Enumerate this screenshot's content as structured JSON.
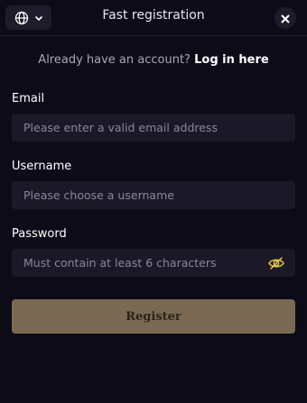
{
  "header": {
    "title": "Fast registration",
    "language_icon": "globe-icon",
    "dropdown_icon": "chevron-down-icon",
    "close_icon": "close-icon"
  },
  "login_prompt": {
    "text": "Already have an account?",
    "link": "Log in here"
  },
  "form": {
    "email": {
      "label": "Email",
      "placeholder": "Please enter a valid email address",
      "value": ""
    },
    "username": {
      "label": "Username",
      "placeholder": "Please choose a username",
      "value": ""
    },
    "password": {
      "label": "Password",
      "placeholder": "Must contain at least 6 characters",
      "value": "",
      "toggle_icon": "eye-slash-icon"
    },
    "submit_label": "Register"
  },
  "colors": {
    "background": "#0d0b17",
    "input_bg": "#1b1927",
    "accent": "#e0c63a",
    "button_bg": "#7a6a54"
  }
}
